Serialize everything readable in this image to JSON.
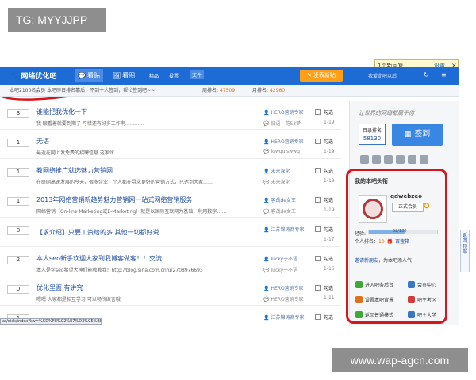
{
  "watermarks": {
    "top_left": "TG: MYYJJPP",
    "bottom_right": "www.wap-agcn.com"
  },
  "notification": {
    "text": "1个新回复",
    "settings": "设置",
    "close": "×"
  },
  "topbar": {
    "logo": "网络优化吧",
    "tabs": [
      {
        "icon": "💬",
        "label": "看贴",
        "active": true
      },
      {
        "icon": "🖼",
        "label": "看图",
        "active": false
      },
      {
        "label": "精品"
      },
      {
        "label": "投票"
      },
      {
        "label": "文件"
      }
    ],
    "post_button": "发表新贴",
    "user_area": "我爱此吧以后"
  },
  "subbar": {
    "text": "本吧2100名会员 本吧昨日排名靠后，不到十人签到，帮忙签到吧~~",
    "week_rank_label": "周排名:",
    "week_rank_value": "47509",
    "month_rank_label": "月排名:",
    "month_rank_value": "42960"
  },
  "threads": [
    {
      "count": "3",
      "title": "谁能把我优化一下",
      "summary": "我  眼看着就要到期了  可惜还有好多工作啊…………",
      "author": "HERO营销专家",
      "last_reply": "旧语 - 花53梦",
      "label": "勾选",
      "date": "1-19"
    },
    {
      "count": "1",
      "title": "无语",
      "summary": "最近在网上发免费的招聘信息  这家伙……",
      "author": "HERO营销专家",
      "last_reply": "lgwqulswwq",
      "label": "勾选",
      "date": "1-19"
    },
    {
      "count": "1",
      "title": "教网络推广就选魅力营销网",
      "summary": "在联网高速发展的今天，很多企业，个人都在寻求更好的营销方式，已达到大家……",
      "author": "未来深化",
      "last_reply": "未来深化",
      "label": "勾选",
      "date": "1-19"
    },
    {
      "count": "1",
      "title": "2013年网络营销新趋势魅力营销网一站式网络营销服务",
      "summary": "网络营销（On-line Marketing或E-Marketing）就是以国际互联网为基础，利用数字……",
      "author": "客战de女王",
      "last_reply": "客战de女王",
      "label": "勾选",
      "date": "1-19"
    },
    {
      "count": "0",
      "title": "【求介绍】只要工资给的多  其他一切都好说",
      "summary": "",
      "author": "江苏锦涛商专家",
      "last_reply": "",
      "label": "勾选",
      "date": "1-17"
    },
    {
      "count": "2",
      "title": "本人seo新手欢迎大家到我博客做客！！交流",
      "summary": "本人是学seo希望大神们能教教我！http://blog.sina.com.cn/u/2708976693",
      "author": "lucky子不语",
      "last_reply": "lucky子不语",
      "label": "勾选",
      "date": "1-16"
    },
    {
      "count": "0",
      "title": "优化里面  有讲究",
      "summary": "嗯嗯  大家都是相互学习  可以畅所欲言哦",
      "author": "HERO营销专家",
      "last_reply": "HERO营销专家",
      "label": "勾选",
      "date": "1-11"
    },
    {
      "count": "1",
      "title": "",
      "summary": "",
      "author": "江苏锦涛商专家",
      "last_reply": "",
      "label": "勾选",
      "date": ""
    }
  ],
  "sidebar": {
    "slogan": "让世界的网络都属于你",
    "rank_label": "目录排名",
    "rank_value": "58130",
    "sign_button": "签到",
    "my_head": "我的本吧头衔",
    "username": "qdwebzeo",
    "member_badge": "正式会员",
    "exp_label": "经验:",
    "exp_text": "52/100",
    "exp_progress": 0.52,
    "personal_rank_label": "个人排名：",
    "personal_rank_value": "10",
    "treasure": "百宝箱",
    "invite": "邀请新朋友，",
    "invite_tail": "为本吧添人气",
    "buttons": [
      {
        "label": "进入吧务后台",
        "color": "#3ea83a"
      },
      {
        "label": "会员中心",
        "color": "#3b76c6"
      },
      {
        "label": "设置本吧背景",
        "color": "#e0701a"
      },
      {
        "label": "吧主考区",
        "color": "#d23b3b"
      },
      {
        "label": "返回普通模式",
        "color": "#3ea83a"
      },
      {
        "label": "吧主大学",
        "color": "#3b76c6"
      }
    ]
  },
  "feedback": "返回顶部",
  "statusbar": "ar/disk/index?kw=%CD%F8%C2%E7%D3%C5%BB%AF"
}
